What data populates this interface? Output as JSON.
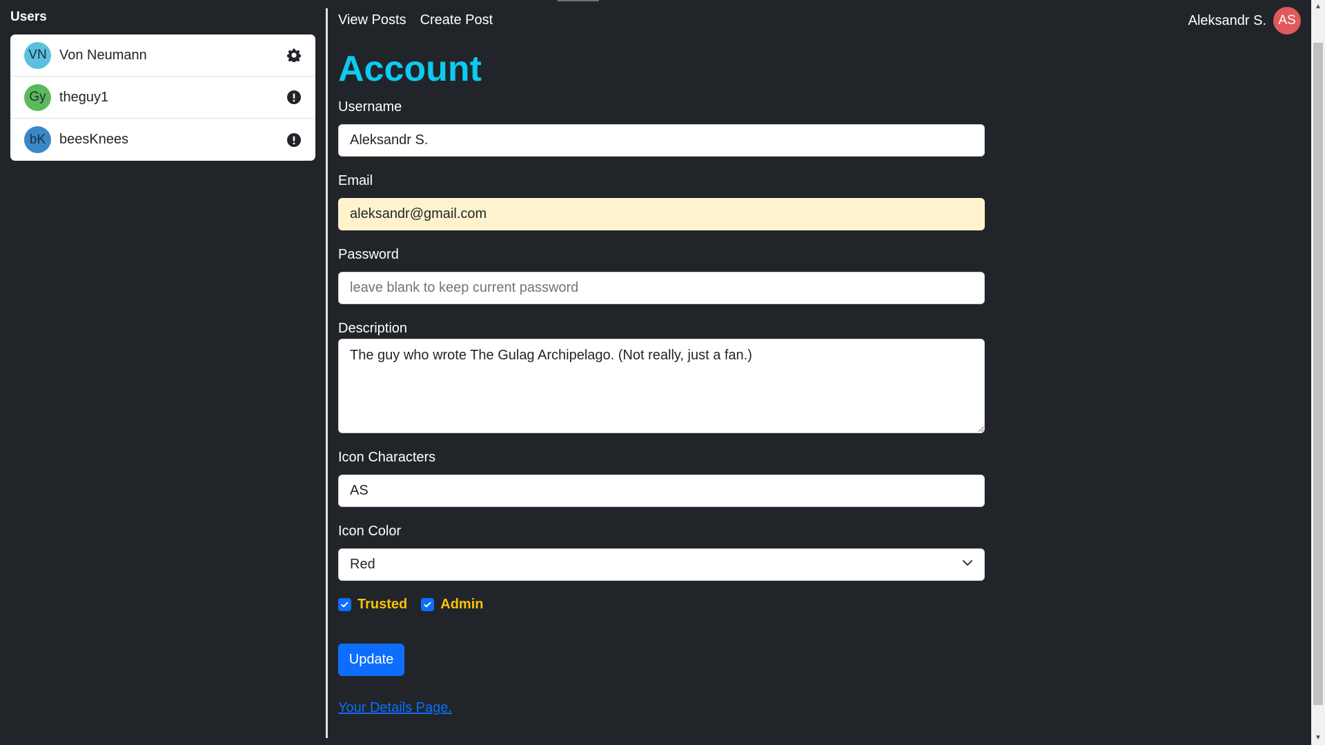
{
  "sidebar": {
    "title": "Users",
    "users": [
      {
        "initials": "VN",
        "name": "Von Neumann",
        "color": "#5bc0de",
        "icon": "gear-icon"
      },
      {
        "initials": "Gy",
        "name": "theguy1",
        "color": "#5cb85c",
        "icon": "exclamation-icon"
      },
      {
        "initials": "bK",
        "name": "beesKnees",
        "color": "#3a87c8",
        "icon": "exclamation-icon"
      }
    ]
  },
  "nav": {
    "view_posts": "View Posts",
    "create_post": "Create Post"
  },
  "current_user": {
    "name": "Aleksandr S.",
    "initials": "AS",
    "color": "#e05a5a"
  },
  "form": {
    "title": "Account",
    "username_label": "Username",
    "username_value": "Aleksandr S.",
    "email_label": "Email",
    "email_value": "aleksandr@gmail.com",
    "password_label": "Password",
    "password_placeholder": "leave blank to keep current password",
    "description_label": "Description",
    "description_value": "The guy who wrote The Gulag Archipelago. (Not really, just a fan.)",
    "icon_chars_label": "Icon Characters",
    "icon_chars_value": "AS",
    "icon_color_label": "Icon Color",
    "icon_color_value": "Red",
    "trusted_label": "Trusted",
    "trusted_checked": true,
    "admin_label": "Admin",
    "admin_checked": true,
    "update_label": "Update",
    "details_link": "Your Details Page."
  },
  "colors": {
    "accent": "#0dcaf0",
    "primary": "#0d6efd",
    "warning": "#ffc107",
    "background": "#212529"
  }
}
